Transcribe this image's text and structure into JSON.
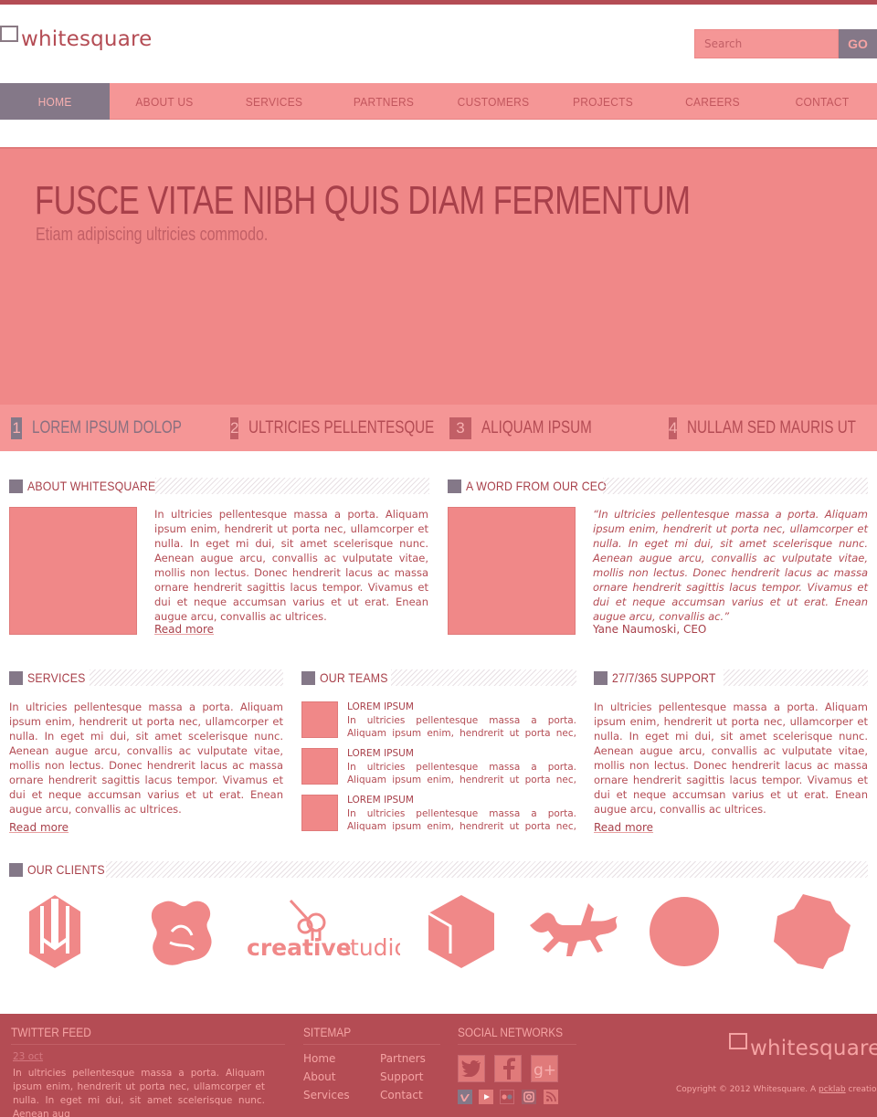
{
  "brand": {
    "logo_text": "whitesquare"
  },
  "search": {
    "placeholder": "Search",
    "button_label": "GO"
  },
  "nav": {
    "items": [
      {
        "label": "HOME",
        "active": true
      },
      {
        "label": "ABOUT US"
      },
      {
        "label": "SERVICES"
      },
      {
        "label": "PARTNERS"
      },
      {
        "label": "CUSTOMERS"
      },
      {
        "label": "PROJECTS"
      },
      {
        "label": "CAREERS"
      },
      {
        "label": "CONTACT"
      }
    ]
  },
  "hero": {
    "title": "FUSCE VITAE NIBH QUIS DIAM FERMENTUM",
    "subtitle": "Etiam adipiscing ultricies commodo.",
    "tabs": [
      {
        "number": "1",
        "label": "LOREM IPSUM DOLOP"
      },
      {
        "number": "2",
        "label": "ULTRICIES PELLENTESQUE"
      },
      {
        "number": "3",
        "label": "ALIQUAM IPSUM"
      },
      {
        "number": "4",
        "label": "NULLAM SED MAURIS UT"
      }
    ]
  },
  "about": {
    "title": "ABOUT WHITESQUARE",
    "text": "In ultricies pellentesque massa a porta. Aliquam ipsum enim, hendrerit ut porta nec, ullamcorper et nulla. In eget mi dui, sit amet scelerisque nunc. Aenean augue arcu, convallis ac vulputate vitae, mollis non lectus. Donec hendrerit lacus ac massa ornare hendrerit sagittis lacus tempor. Vivamus et dui et neque accumsan varius et ut erat. Enean augue arcu, convallis ac ultrices.",
    "read_more": "Read more"
  },
  "ceo": {
    "title": "A WORD FROM OUR CEO",
    "quote": "“In ultricies pellentesque massa a porta. Aliquam ipsum enim, hendrerit ut porta nec, ullamcorper et nulla. In eget mi dui, sit amet scelerisque nunc. Aenean augue arcu, convallis ac vulputate vitae, mollis non lectus. Donec hendrerit lacus ac massa ornare hendrerit sagittis lacus tempor. Vivamus et dui et neque accumsan varius et ut erat. Enean augue arcu, convallis ac.”",
    "signature": "Yane Naumoski, CEO"
  },
  "services": {
    "title": "SERVICES",
    "text": "In ultricies pellentesque massa a porta. Aliquam ipsum enim, hendrerit ut porta nec, ullamcorper et nulla. In eget mi dui, sit amet scelerisque nunc. Aenean augue arcu, convallis ac vulputate vitae, mollis non lectus. Donec hendrerit lacus ac massa ornare hendrerit sagittis lacus tempor. Vivamus et dui et neque accumsan varius et ut erat. Enean augue arcu, convallis ac ultrices.",
    "read_more": "Read more"
  },
  "teams": {
    "title": "OUR TEAMS",
    "items": [
      {
        "name": "LOREM IPSUM",
        "text": "In ultricies pellentesque massa a porta. Aliquam ipsum enim, hendrerit ut porta nec, ullamcorper et"
      },
      {
        "name": "LOREM IPSUM",
        "text": "In ultricies pellentesque massa a porta. Aliquam ipsum enim, hendrerit ut porta nec, ullamcorper et"
      },
      {
        "name": "LOREM IPSUM",
        "text": "In ultricies pellentesque massa a porta. Aliquam ipsum enim, hendrerit ut porta nec, ullamcorper et"
      }
    ]
  },
  "support": {
    "title": "27/7/365 SUPPORT",
    "text": "In ultricies pellentesque massa a porta. Aliquam ipsum enim, hendrerit ut porta nec, ullamcorper et nulla. In eget mi dui, sit amet scelerisque nunc. Aenean augue arcu, convallis ac vulputate vitae, mollis non lectus. Donec hendrerit lacus ac massa ornare hendrerit sagittis lacus tempor. Vivamus et dui et neque accumsan varius et ut erat. Enean augue arcu, convallis ac ultrices.",
    "read_more": "Read more"
  },
  "clients": {
    "title": "OUR CLIENTS",
    "logos": [
      "shield-logo",
      "knot-logo",
      "creativestudio",
      "hexagon-logo",
      "horse-logo",
      "circle-logo",
      "octagon-logo"
    ],
    "creative_studio": {
      "bold": "creative",
      "light": "studio"
    }
  },
  "footer": {
    "twitter": {
      "title": "TWITTER FEED",
      "date": "23 oct",
      "text": "In ultricies pellentesque massa a porta. Aliquam ipsum enim, hendrerit ut porta nec, ullamcorper et nulla. In eget mi dui, sit amet scelerisque nunc. Aenean aug"
    },
    "sitemap": {
      "title": "SITEMAP",
      "col1": [
        "Home",
        "About",
        "Services"
      ],
      "col2": [
        "Partners",
        "Support",
        "Contact"
      ]
    },
    "social": {
      "title": "SOCIAL NETWORKS",
      "big_icons": [
        "twitter-icon",
        "facebook-icon",
        "google-plus-icon"
      ],
      "small_icons": [
        "vimeo-icon",
        "youtube-icon",
        "flickr-icon",
        "instagram-icon",
        "rss-icon"
      ]
    },
    "logo_text": "whitesquare",
    "copyright_prefix": "Copyright © 2012 Whitesquare. A ",
    "copyright_link": "pcklab",
    "copyright_suffix": " creation"
  },
  "colors": {
    "accent": "#b44c54",
    "primary_pink": "#f08888",
    "nav_pink": "#f59696",
    "active_slate": "#847888"
  }
}
